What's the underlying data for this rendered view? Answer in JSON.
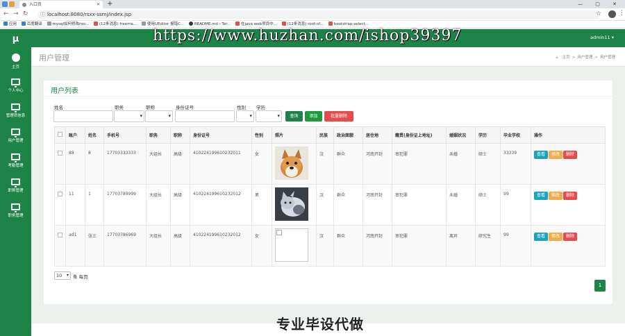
{
  "browser": {
    "tab_title": "入口页",
    "url": "localhost:8080/rsxx-ssmj/index.jsp",
    "bookmarks": [
      "应用",
      "百度翻译",
      "mysql如何修改roo...",
      "(12条消息) freema...",
      "使用UEditor 报错C...",
      "README.md - Ter...",
      "在java web项目中...",
      "(12条消息) root of...",
      "bootstrap-select..."
    ]
  },
  "watermark": "https://www.huzhan.com/ishop39397",
  "banner": "专业毕设代做",
  "app": {
    "logo": "μ",
    "user": "admin11 ▾",
    "sidebar": [
      {
        "label": "主页",
        "icon": "home-icon"
      },
      {
        "label": "个人中心",
        "icon": "monitor-icon"
      },
      {
        "label": "管理员信息",
        "icon": "monitor-icon"
      },
      {
        "label": "用户管理",
        "icon": "monitor-icon"
      },
      {
        "label": "考勤管理",
        "icon": "monitor-icon"
      },
      {
        "label": "职称管理",
        "icon": "monitor-icon"
      },
      {
        "label": "职务管理",
        "icon": "monitor-icon"
      }
    ],
    "page_title": "用户管理",
    "breadcrumb": [
      "主页",
      "用户管理",
      "用户管理"
    ]
  },
  "card": {
    "title": "用户列表",
    "filters": {
      "name": "姓名",
      "post": "职务",
      "title_rank": "职称",
      "id_card": "身份证号",
      "gender": "性别",
      "education": "学历"
    },
    "buttons": {
      "search": "查询",
      "add": "添加",
      "bulk_delete": "批量删除"
    },
    "columns": [
      "账户",
      "姓名",
      "手机号",
      "职务",
      "职称",
      "身份证号",
      "性别",
      "照片",
      "民族",
      "政治面貌",
      "居住地",
      "籍贯(身份证上地址)",
      "婚姻状况",
      "学历",
      "毕业学校",
      "操作"
    ],
    "rows": [
      {
        "account": "88",
        "name": "8",
        "phone": "17703333333",
        "post": "大组长",
        "rank": "高级",
        "id_card": "410224199610232011",
        "gender": "女",
        "photo": "dog",
        "ethnic": "汉",
        "political": "群众",
        "residence": "河南开封",
        "origin": "审犯罪",
        "marital": "未婚",
        "education": "硕士",
        "school": "33339"
      },
      {
        "account": "11",
        "name": "1",
        "phone": "17703789999",
        "post": "大组长",
        "rank": "高级",
        "id_card": "410224199610232012",
        "gender": "男",
        "photo": "cat",
        "ethnic": "汉",
        "political": "群众",
        "residence": "河南开封",
        "origin": "审犯罪",
        "marital": "未婚",
        "education": "硕士",
        "school": "99"
      },
      {
        "account": "ad1",
        "name": "张三",
        "phone": "17703786969",
        "post": "大组长",
        "rank": "高级",
        "id_card": "410224199610232012",
        "gender": "女",
        "photo": "broken",
        "ethnic": "汉",
        "political": "群众",
        "residence": "河南开封",
        "origin": "审犯罪",
        "marital": "离异",
        "education": "研究生",
        "school": "99"
      }
    ],
    "actions": {
      "view": "查看",
      "edit": "修改",
      "delete": "删除"
    },
    "page_size": "10",
    "per_page_label": "条 每页",
    "current_page": "1"
  }
}
